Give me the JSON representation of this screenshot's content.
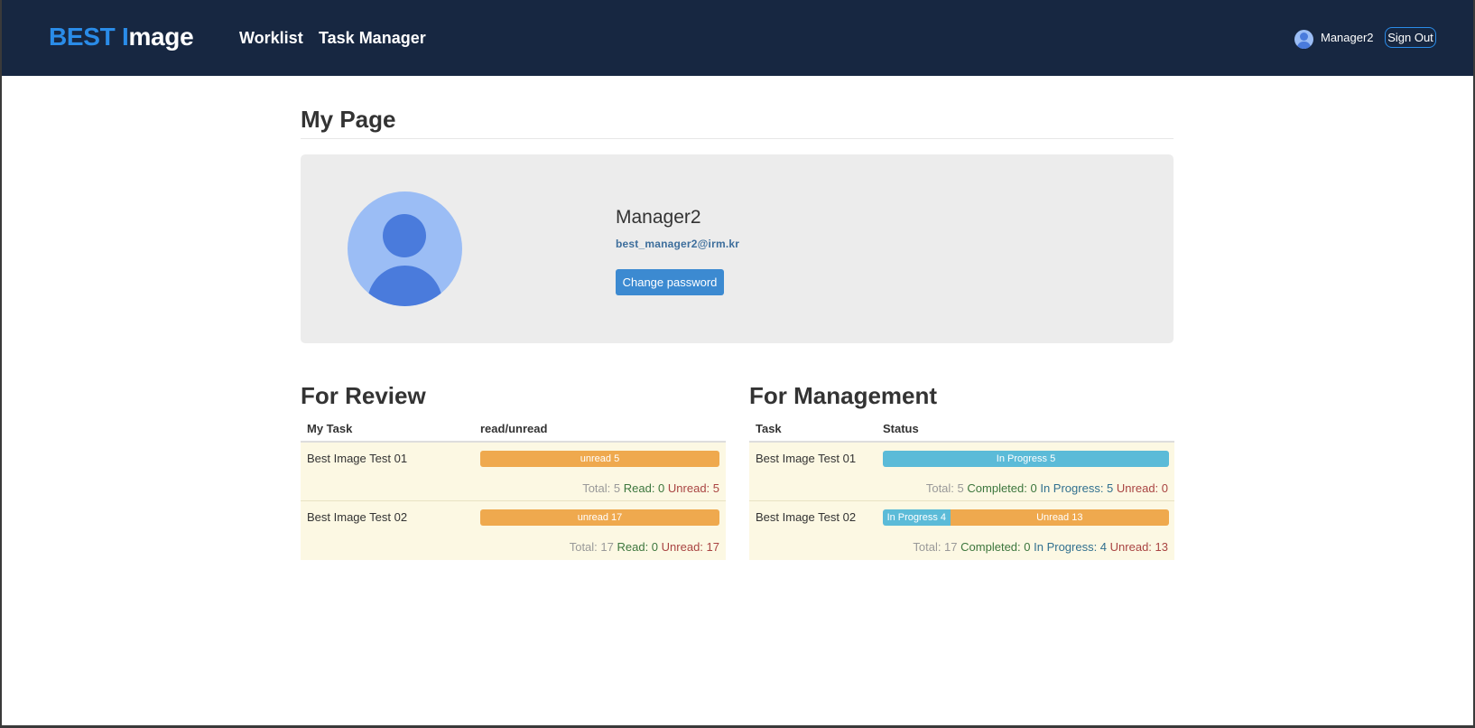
{
  "navbar": {
    "brand_prefix": "BEST I",
    "brand_suffix": "mage",
    "links": [
      "Worklist",
      "Task Manager"
    ],
    "user_name": "Manager2",
    "signout_label": "Sign Out"
  },
  "page": {
    "title": "My Page"
  },
  "profile": {
    "name": "Manager2",
    "email": "best_manager2@irm.kr",
    "change_password_label": "Change password"
  },
  "review": {
    "title": "For Review",
    "col_task": "My Task",
    "col_status": "read/unread",
    "rows": [
      {
        "name": "Best Image Test 01",
        "bar": [
          {
            "label": "unread 5",
            "kind": "warn",
            "fraction": 1.0
          }
        ],
        "summary": [
          {
            "text": "Total: 5",
            "kind": "total"
          },
          {
            "text": "Read: 0",
            "kind": "read"
          },
          {
            "text": "Unread: 5",
            "kind": "unread"
          }
        ]
      },
      {
        "name": "Best Image Test 02",
        "bar": [
          {
            "label": "unread 17",
            "kind": "warn",
            "fraction": 1.0
          }
        ],
        "summary": [
          {
            "text": "Total: 17",
            "kind": "total"
          },
          {
            "text": "Read: 0",
            "kind": "read"
          },
          {
            "text": "Unread: 17",
            "kind": "unread"
          }
        ]
      }
    ]
  },
  "management": {
    "title": "For Management",
    "col_task": "Task",
    "col_status": "Status",
    "rows": [
      {
        "name": "Best Image Test 01",
        "bar": [
          {
            "label": "In Progress 5",
            "kind": "info",
            "fraction": 1.0
          }
        ],
        "summary": [
          {
            "text": "Total: 5",
            "kind": "total"
          },
          {
            "text": "Completed: 0",
            "kind": "read"
          },
          {
            "text": "In Progress: 5",
            "kind": "prog"
          },
          {
            "text": "Unread: 0",
            "kind": "unread"
          }
        ]
      },
      {
        "name": "Best Image Test 02",
        "bar": [
          {
            "label": "In Progress 4",
            "kind": "info",
            "fraction": 0.2353
          },
          {
            "label": "Unread 13",
            "kind": "warn",
            "fraction": 0.7647
          }
        ],
        "summary": [
          {
            "text": "Total: 17",
            "kind": "total"
          },
          {
            "text": "Completed: 0",
            "kind": "read"
          },
          {
            "text": "In Progress: 4",
            "kind": "prog"
          },
          {
            "text": "Unread: 13",
            "kind": "unread"
          }
        ]
      }
    ]
  }
}
